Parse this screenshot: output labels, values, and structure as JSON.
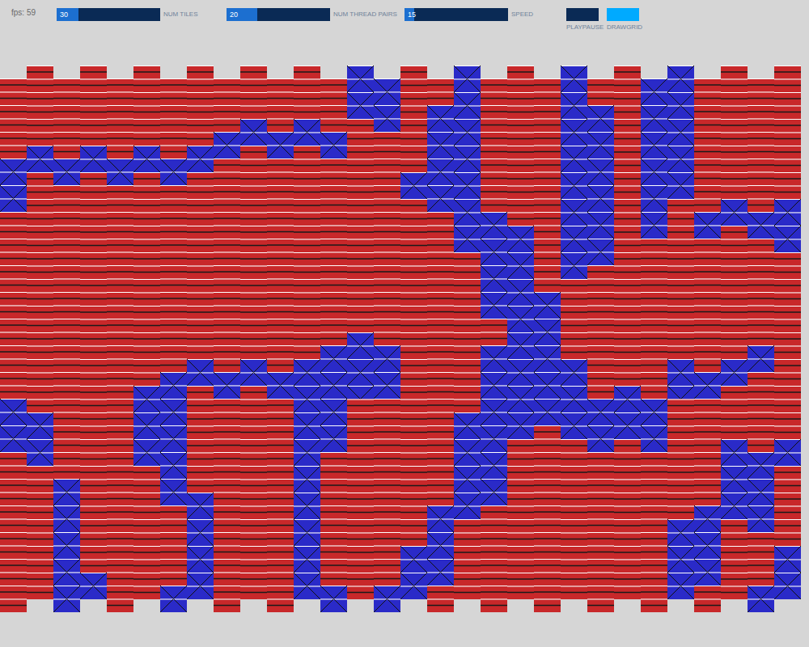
{
  "fps": "fps: 59",
  "sliders": [
    {
      "label": "NUM TILES",
      "value": "30",
      "level": 0.21
    },
    {
      "label": "NUM THREAD PAIRS",
      "value": "20",
      "level": 0.3
    },
    {
      "label": "SPEED",
      "value": "15",
      "level": 0.09
    }
  ],
  "buttons": [
    {
      "label": "PLAYPAUSE",
      "on": false
    },
    {
      "label": "DRAWGRID",
      "on": true
    }
  ],
  "weave": {
    "columns": [
      {
        "blue": [
          [
            6,
            9
          ],
          [
            24,
            27
          ]
        ]
      },
      {
        "blue": [
          [
            6,
            7
          ],
          [
            26,
            29
          ]
        ]
      },
      {
        "blue": [
          [
            6,
            7
          ],
          [
            30,
            39
          ]
        ]
      },
      {
        "blue": [
          [
            6,
            7
          ],
          [
            38,
            39
          ]
        ]
      },
      {
        "blue": [
          [
            6,
            7
          ]
        ]
      },
      {
        "blue": [
          [
            6,
            7
          ],
          [
            24,
            29
          ]
        ]
      },
      {
        "blue": [
          [
            6,
            7
          ],
          [
            22,
            31
          ],
          [
            38,
            39
          ]
        ]
      },
      {
        "blue": [
          [
            6,
            7
          ],
          [
            22,
            23
          ],
          [
            32,
            39
          ]
        ]
      },
      {
        "blue": [
          [
            4,
            5
          ],
          [
            22,
            23
          ]
        ]
      },
      {
        "blue": [
          [
            4,
            5
          ],
          [
            22,
            23
          ]
        ]
      },
      {
        "blue": [
          [
            4,
            5
          ],
          [
            22,
            23
          ]
        ]
      },
      {
        "blue": [
          [
            4,
            5
          ],
          [
            22,
            39
          ]
        ]
      },
      {
        "blue": [
          [
            4,
            5
          ],
          [
            20,
            27
          ],
          [
            38,
            39
          ]
        ]
      },
      {
        "blue": [
          [
            0,
            3
          ],
          [
            20,
            24
          ]
        ]
      },
      {
        "blue": [
          [
            0,
            3
          ],
          [
            20,
            23
          ],
          [
            38,
            39
          ]
        ]
      },
      {
        "blue": [
          [
            8,
            9
          ],
          [
            36,
            39
          ]
        ]
      },
      {
        "blue": [
          [
            2,
            9
          ],
          [
            32,
            37
          ]
        ]
      },
      {
        "blue": [
          [
            0,
            13
          ],
          [
            26,
            33
          ]
        ]
      },
      {
        "blue": [
          [
            10,
            17
          ],
          [
            20,
            31
          ]
        ]
      },
      {
        "blue": [
          [
            12,
            27
          ]
        ]
      },
      {
        "blue": [
          [
            16,
            25
          ]
        ]
      },
      {
        "blue": [
          [
            0,
            15
          ],
          [
            22,
            27
          ]
        ]
      },
      {
        "blue": [
          [
            2,
            13
          ],
          [
            24,
            27
          ]
        ]
      },
      {
        "blue": [
          [
            24,
            27
          ]
        ]
      },
      {
        "blue": [
          [
            0,
            11
          ],
          [
            24,
            27
          ]
        ]
      },
      {
        "blue": [
          [
            0,
            9
          ],
          [
            22,
            24
          ],
          [
            34,
            39
          ]
        ]
      },
      {
        "blue": [
          [
            10,
            11
          ],
          [
            22,
            23
          ],
          [
            32,
            37
          ]
        ]
      },
      {
        "blue": [
          [
            10,
            11
          ],
          [
            22,
            23
          ],
          [
            28,
            33
          ]
        ]
      },
      {
        "blue": [
          [
            10,
            11
          ],
          [
            20,
            21
          ],
          [
            28,
            33
          ],
          [
            38,
            39
          ]
        ]
      },
      {
        "blue": [
          [
            10,
            13
          ],
          [
            28,
            29
          ],
          [
            36,
            39
          ]
        ]
      }
    ]
  }
}
